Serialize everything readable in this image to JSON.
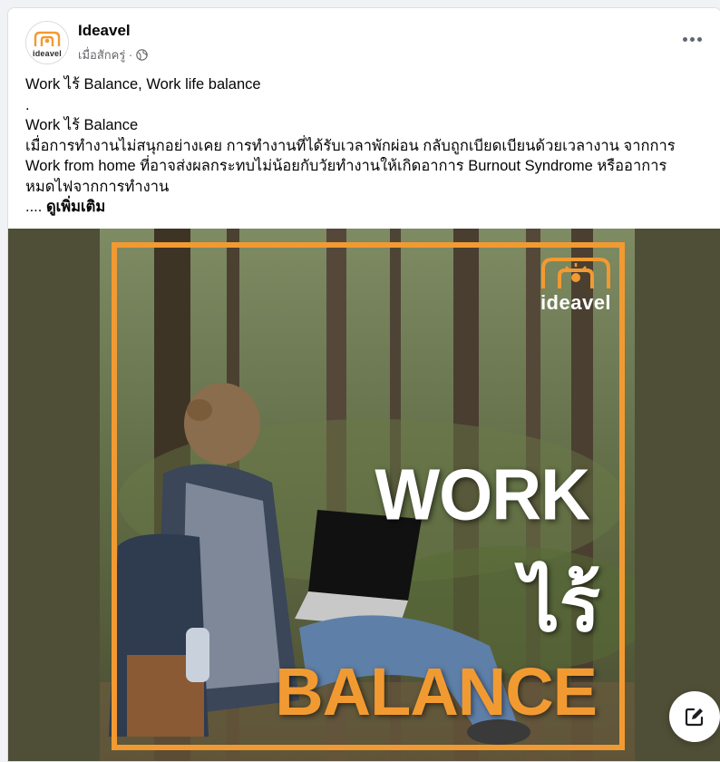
{
  "post": {
    "page_name": "Ideavel",
    "avatar_text": "ideavel",
    "meta_text": "เมื่อสักครู่ ·",
    "privacy_icon": "globe-icon",
    "more_icon": "more-horizontal-icon",
    "text_lines": [
      "Work ไร้ Balance, Work life balance",
      ".",
      "Work ไร้ Balance",
      "เมื่อการทำงานไม่สนุกอย่างเคย การทำงานที่ได้รับเวลาพักผ่อน กลับถูกเบียดเบียนด้วยเวลางาน จากการ",
      "Work from home ที่อาจส่งผลกระทบไม่น้อยกับวัยทำงานให้เกิดอาการ Burnout Syndrome หรืออาการ",
      "หมดไฟจากการทำงาน"
    ],
    "ellipsis": "....",
    "see_more": "ดูเพิ่มเติม"
  },
  "image": {
    "logo_text": "ideavel",
    "title_line1": "WORK",
    "title_line2": "ไร้",
    "title_line3": "BALANCE",
    "accent_color": "#f29a32",
    "background_color": "#4f4f37"
  },
  "fab": {
    "icon": "compose-icon"
  }
}
